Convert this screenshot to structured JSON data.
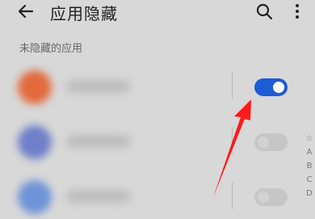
{
  "header": {
    "title": "应用隐藏",
    "back_icon": "arrow-left-icon",
    "search_icon": "search-icon",
    "more_icon": "more-vertical-icon"
  },
  "section": {
    "label": "未隐藏的应用"
  },
  "apps": [
    {
      "icon_color": "#e26a3c",
      "hidden_enabled": true
    },
    {
      "icon_color": "#6f7fc9",
      "hidden_enabled": false
    },
    {
      "icon_color": "#6e93d8",
      "hidden_enabled": false
    }
  ],
  "index_bar": [
    "☆",
    "A",
    "B",
    "C",
    "D"
  ],
  "colors": {
    "toggle_on": "#1e5bd6",
    "annotation_arrow": "#ff1a1a"
  }
}
